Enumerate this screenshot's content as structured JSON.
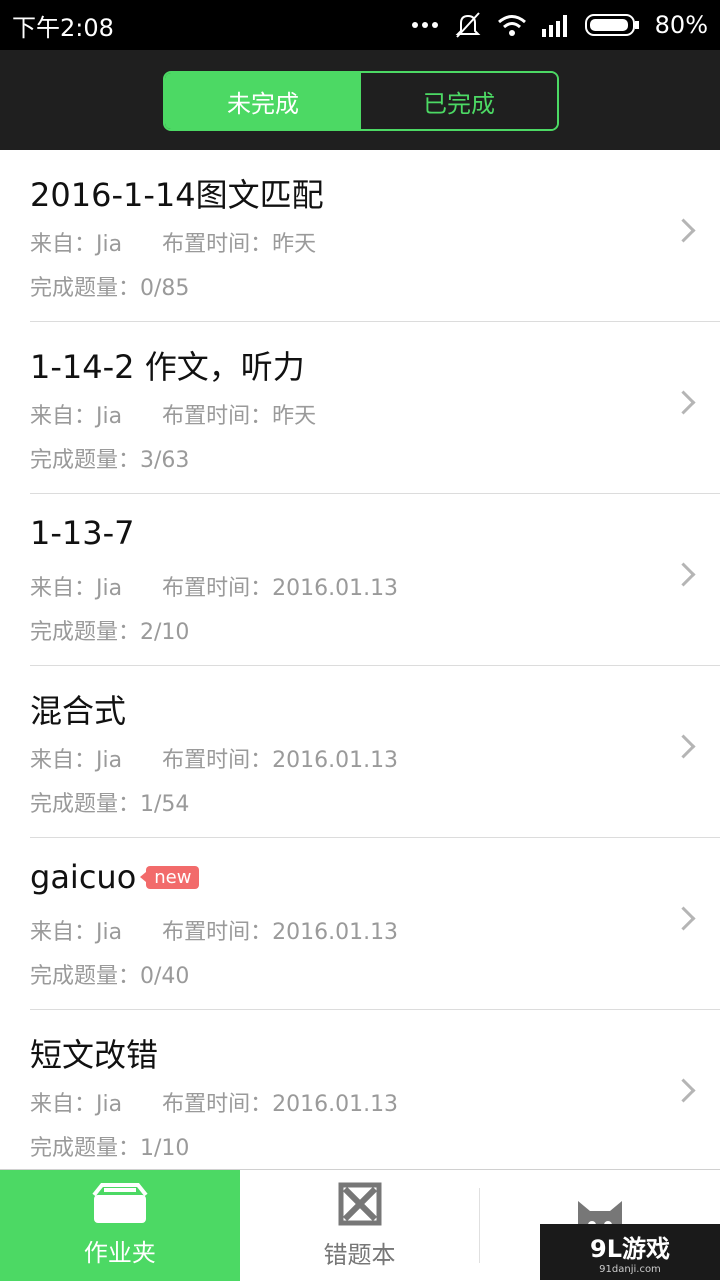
{
  "status": {
    "time": "下午2:08",
    "battery": "80%"
  },
  "segment": {
    "active": "未完成",
    "inactive": "已完成"
  },
  "items": [
    {
      "title": "2016-1-14图文匹配",
      "from": "来自：Jia",
      "assigned": "布置时间：昨天",
      "progress": "完成题量：0/85",
      "badge": ""
    },
    {
      "title": "1-14-2 作文，听力",
      "from": "来自：Jia",
      "assigned": "布置时间：昨天",
      "progress": "完成题量：3/63",
      "badge": ""
    },
    {
      "title": "1-13-7",
      "from": "来自：Jia",
      "assigned": "布置时间：2016.01.13",
      "progress": "完成题量：2/10",
      "badge": ""
    },
    {
      "title": "混合式",
      "from": "来自：Jia",
      "assigned": "布置时间：2016.01.13",
      "progress": "完成题量：1/54",
      "badge": ""
    },
    {
      "title": "gaicuo",
      "from": "来自：Jia",
      "assigned": "布置时间：2016.01.13",
      "progress": "完成题量：0/40",
      "badge": "new"
    },
    {
      "title": "短文改错",
      "from": "来自：Jia",
      "assigned": "布置时间：2016.01.13",
      "progress": "完成题量：1/10",
      "badge": ""
    }
  ],
  "tabs": [
    {
      "label": "作业夹",
      "icon": "folder-icon"
    },
    {
      "label": "错题本",
      "icon": "wrong-book-icon"
    },
    {
      "label": "",
      "icon": "cat-icon"
    }
  ],
  "watermark": {
    "main": "9L游戏",
    "sub": "91danji.com"
  },
  "colors": {
    "accent": "#4cd964",
    "badge": "#f26b6b"
  }
}
